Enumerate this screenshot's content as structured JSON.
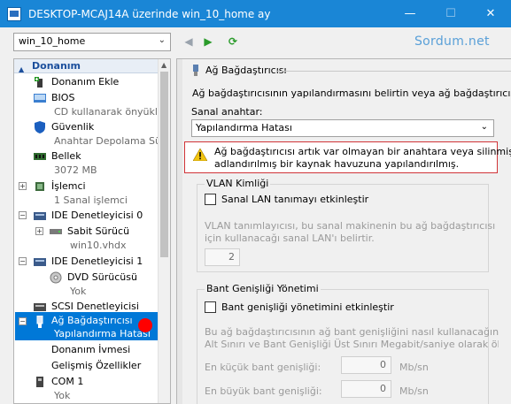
{
  "window": {
    "title": "DESKTOP-MCAJ14A üzerinde win_10_home ay",
    "minimize": "—",
    "maximize": "☐",
    "close": "✕"
  },
  "toolbar": {
    "vm_name": "win_10_home",
    "brand": "Sordum.net"
  },
  "tree": {
    "header": "Donanım",
    "items": [
      {
        "label": "Donanım Ekle"
      },
      {
        "label": "BIOS",
        "sub": "CD kullanarak önyükle"
      },
      {
        "label": "Güvenlik",
        "sub": "Anahtar Depolama Sürü"
      },
      {
        "label": "Bellek",
        "sub": "3072 MB"
      },
      {
        "label": "İşlemci",
        "sub": "1 Sanal işlemci"
      },
      {
        "label": "IDE Denetleyicisi 0"
      },
      {
        "label": "Sabit Sürücü",
        "sub": "win10.vhdx"
      },
      {
        "label": "IDE Denetleyicisi 1"
      },
      {
        "label": "DVD Sürücüsü",
        "sub": "Yok"
      },
      {
        "label": "SCSI Denetleyicisi"
      },
      {
        "label": "Ağ Bağdaştırıcısı",
        "sub": "Yapılandırma Hatası"
      },
      {
        "label": "Donanım İvmesi"
      },
      {
        "label": "Gelişmiş Özellikler"
      },
      {
        "label": "COM 1",
        "sub": "Yok"
      }
    ]
  },
  "panel": {
    "title": "Ağ Bağdaştırıcısı",
    "description": "Ağ bağdaştırıcısının yapılandırmasını belirtin veya ağ bağdaştırıcısını kaldı",
    "switch_label": "Sanal anahtar:",
    "switch_value": "Yapılandırma Hatası",
    "warning_line1": "Ağ bağdaştırıcısı artık var olmayan bir anahtara veya silinmiş ya da",
    "warning_line2": "adlandırılmış bir kaynak havuzuna yapılandırılmış.",
    "vlan": {
      "title": "VLAN Kimliği",
      "checkbox_label": "Sanal LAN tanımayı etkinleştir",
      "info_line1": "VLAN tanımlayıcısı, bu sanal makinenin bu ağ bağdaştırıcısı aracılığıyla",
      "info_line2": "için kullanacağı sanal LAN'ı belirtir.",
      "value": "2"
    },
    "bandwidth": {
      "title": "Bant Genişliği Yönetimi",
      "checkbox_label": "Bant genişliği yönetimini etkinleştir",
      "info_line1": "Bu ağ bağdaştırıcısının ağ bant genişliğini nasıl kullanacağını belirtin.",
      "info_line2": "Alt Sınırı ve Bant Genişliği Üst Sınırı Megabit/saniye olarak ölçülür.",
      "min_label": "En küçük bant genişliği:",
      "min_value": "0",
      "max_label": "En büyük bant genişliği:",
      "max_value": "0",
      "unit": "Mb/sn"
    }
  }
}
